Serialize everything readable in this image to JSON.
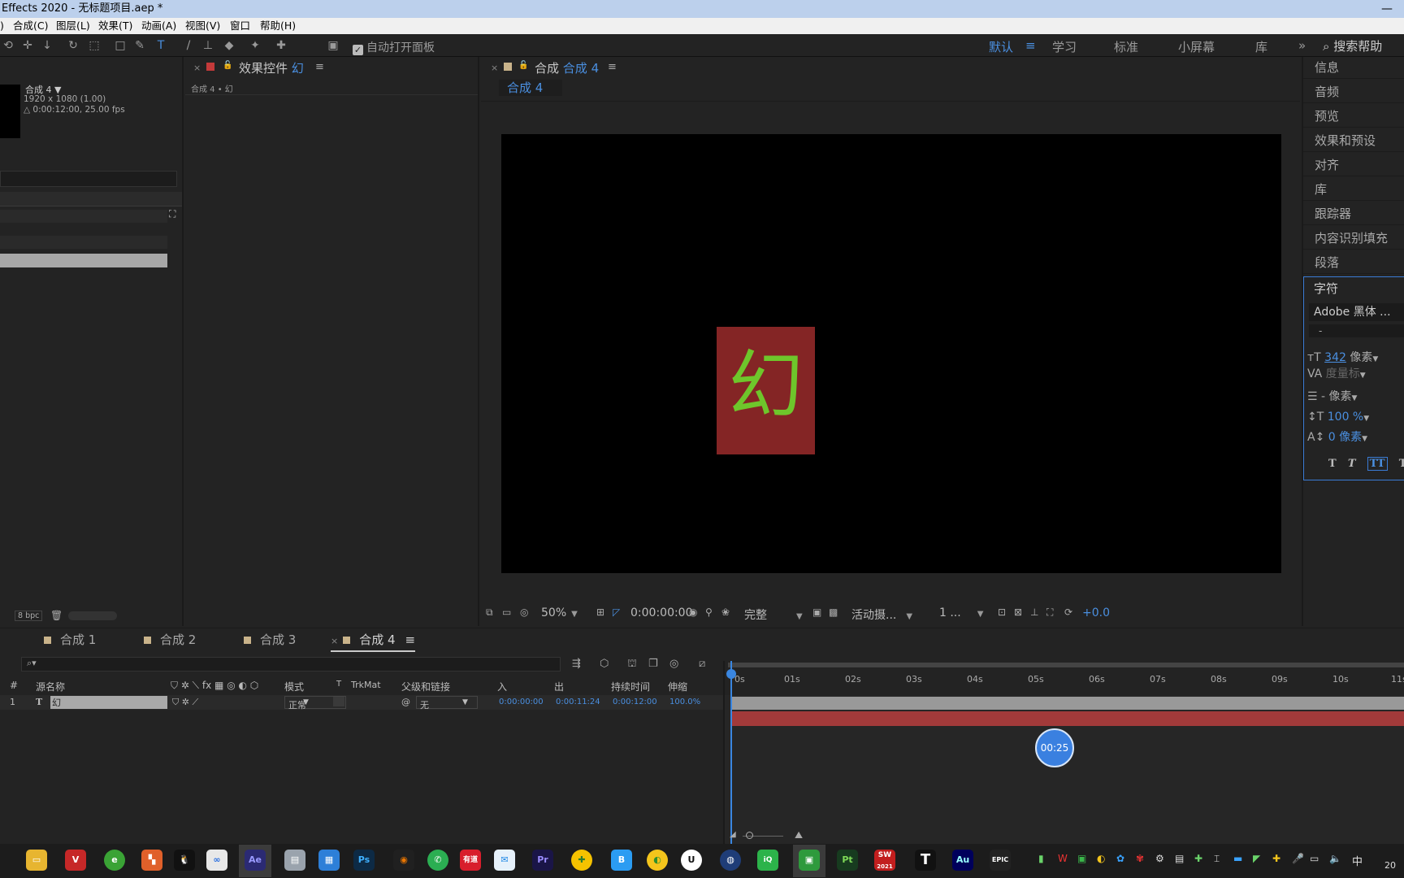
{
  "window": {
    "title": "Effects 2020 - 无标题项目.aep *",
    "minimize": "—"
  },
  "menu": [
    "合成(C)",
    "图层(L)",
    "效果(T)",
    "动画(A)",
    "视图(V)",
    "窗口",
    "帮助(H)"
  ],
  "toolbar": {
    "auto_open_panel": "自动打开面板",
    "workspaces": [
      "默认",
      "学习",
      "标准",
      "小屏幕",
      "库"
    ],
    "active_workspace": "默认",
    "more": "»",
    "search_help": "搜索帮助"
  },
  "project": {
    "comp_name": "合成 4 ▼",
    "info_resolution": "1920 x 1080 (1.00)",
    "info_duration": "△ 0:00:12:00, 25.00 fps",
    "bpc": "8 bpc"
  },
  "effects": {
    "tab_prefix": "效果控件",
    "tab_layer": "幻",
    "breadcrumb": "合成 4 • 幻"
  },
  "comp": {
    "tab_prefix": "合成",
    "tab_name": "合成 4",
    "subtab": "合成 4",
    "glyph": "幻",
    "zoom": "50%",
    "timecode": "0:00:00:00",
    "resolution": "完整",
    "camera": "活动摄...",
    "views": "1 ...",
    "exposure": "+0.0"
  },
  "right_panels": [
    "信息",
    "音频",
    "预览",
    "效果和预设",
    "对齐",
    "库",
    "跟踪器",
    "内容识别填充",
    "段落"
  ],
  "character": {
    "title": "字符",
    "font": "Adobe 黑体 ...",
    "style": "-",
    "size": "342",
    "size_unit": "像素",
    "kerning": "度量标",
    "leading": "- 像素",
    "vscale": "100 %",
    "baseline": "0 像素",
    "styles": [
      "T",
      "T",
      "TT",
      "Tт"
    ]
  },
  "timeline": {
    "tabs": [
      "合成 1",
      "合成 2",
      "合成 3",
      "合成 4"
    ],
    "active_tab": "合成 4",
    "columns": {
      "num": "#",
      "source": "源名称",
      "mode": "模式",
      "t": "T",
      "trkmat": "TrkMat",
      "parent": "父级和链接",
      "in": "入",
      "out": "出",
      "duration": "持续时间",
      "stretch": "伸缩"
    },
    "layer": {
      "num": "1",
      "type": "T",
      "name": "幻",
      "mode": "正常",
      "parent": "无",
      "in": "0:00:00:00",
      "out": "0:00:11:24",
      "duration": "0:00:12:00",
      "stretch": "100.0%"
    },
    "ruler": [
      "0s",
      "01s",
      "02s",
      "03s",
      "04s",
      "05s",
      "06s",
      "07s",
      "08s",
      "09s",
      "10s",
      "11s"
    ],
    "hover_time": "00:25"
  },
  "taskbar": {
    "apps": [
      "folder",
      "vsc",
      "360",
      "office",
      "qq",
      "baidu",
      "Ae",
      "files",
      "store",
      "Ps",
      "blender",
      "wechat",
      "youdao",
      "qqmail",
      "Pr",
      "plus",
      "B",
      "lemon",
      "unreal",
      "c4d",
      "iqiyi",
      "camtasia",
      "Pt",
      "SW",
      "T",
      "Au",
      "EPIC"
    ],
    "sw_year": "2021",
    "clock": "20",
    "ime": "中"
  }
}
